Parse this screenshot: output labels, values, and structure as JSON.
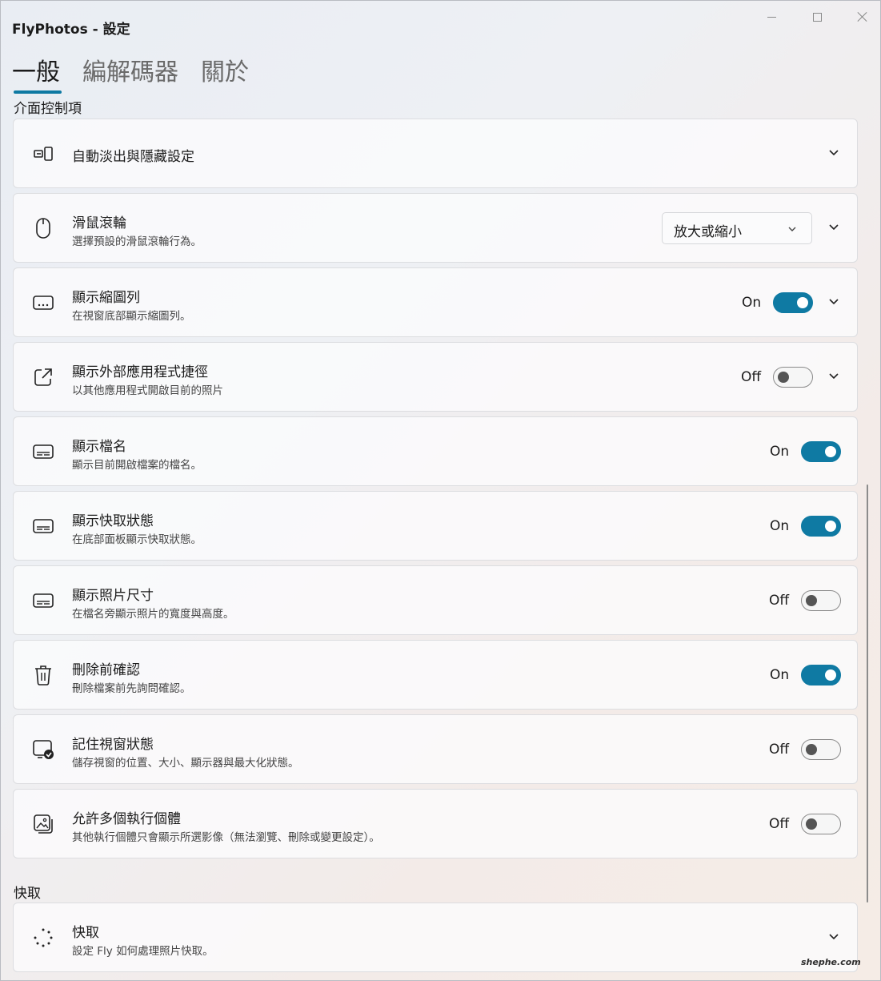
{
  "window": {
    "title": "FlyPhotos - 設定"
  },
  "tabs": [
    {
      "label": "一般",
      "active": true
    },
    {
      "label": "編解碼器",
      "active": false
    },
    {
      "label": "關於",
      "active": false
    }
  ],
  "sections": {
    "ui_controls": "介面控制項",
    "cache": "快取"
  },
  "settings": [
    {
      "icon": "fade-hide-icon",
      "title": "自動淡出與隱藏設定",
      "desc": "",
      "control": "expander"
    },
    {
      "icon": "mouse-icon",
      "title": "滑鼠滾輪",
      "desc": "選擇預設的滑鼠滾輪行為。",
      "control": "dropdown",
      "value": "放大或縮小"
    },
    {
      "icon": "thumbnail-strip-icon",
      "title": "顯示縮圖列",
      "desc": "在視窗底部顯示縮圖列。",
      "control": "toggle-expander",
      "state": "On"
    },
    {
      "icon": "open-external-icon",
      "title": "顯示外部應用程式捷徑",
      "desc": "以其他應用程式開啟目前的照片",
      "control": "toggle-expander",
      "state": "Off"
    },
    {
      "icon": "caption-icon",
      "title": "顯示檔名",
      "desc": "顯示目前開啟檔案的檔名。",
      "control": "toggle",
      "state": "On"
    },
    {
      "icon": "caption-icon",
      "title": "顯示快取狀態",
      "desc": "在底部面板顯示快取狀態。",
      "control": "toggle",
      "state": "On"
    },
    {
      "icon": "caption-icon",
      "title": "顯示照片尺寸",
      "desc": "在檔名旁顯示照片的寬度與高度。",
      "control": "toggle",
      "state": "Off"
    },
    {
      "icon": "trash-icon",
      "title": "刪除前確認",
      "desc": "刪除檔案前先詢問確認。",
      "control": "toggle",
      "state": "On"
    },
    {
      "icon": "window-check-icon",
      "title": "記住視窗狀態",
      "desc": "儲存視窗的位置、大小、顯示器與最大化狀態。",
      "control": "toggle",
      "state": "Off"
    },
    {
      "icon": "multi-image-icon",
      "title": "允許多個執行個體",
      "desc": "其他執行個體只會顯示所選影像（無法瀏覽、刪除或變更設定）。",
      "control": "toggle",
      "state": "Off"
    }
  ],
  "cache_setting": {
    "icon": "spinner-icon",
    "title": "快取",
    "desc": "設定 Fly 如何處理照片快取。",
    "control": "expander"
  },
  "watermark": "shephe.com",
  "colors": {
    "accent": "#0f7aa3"
  }
}
